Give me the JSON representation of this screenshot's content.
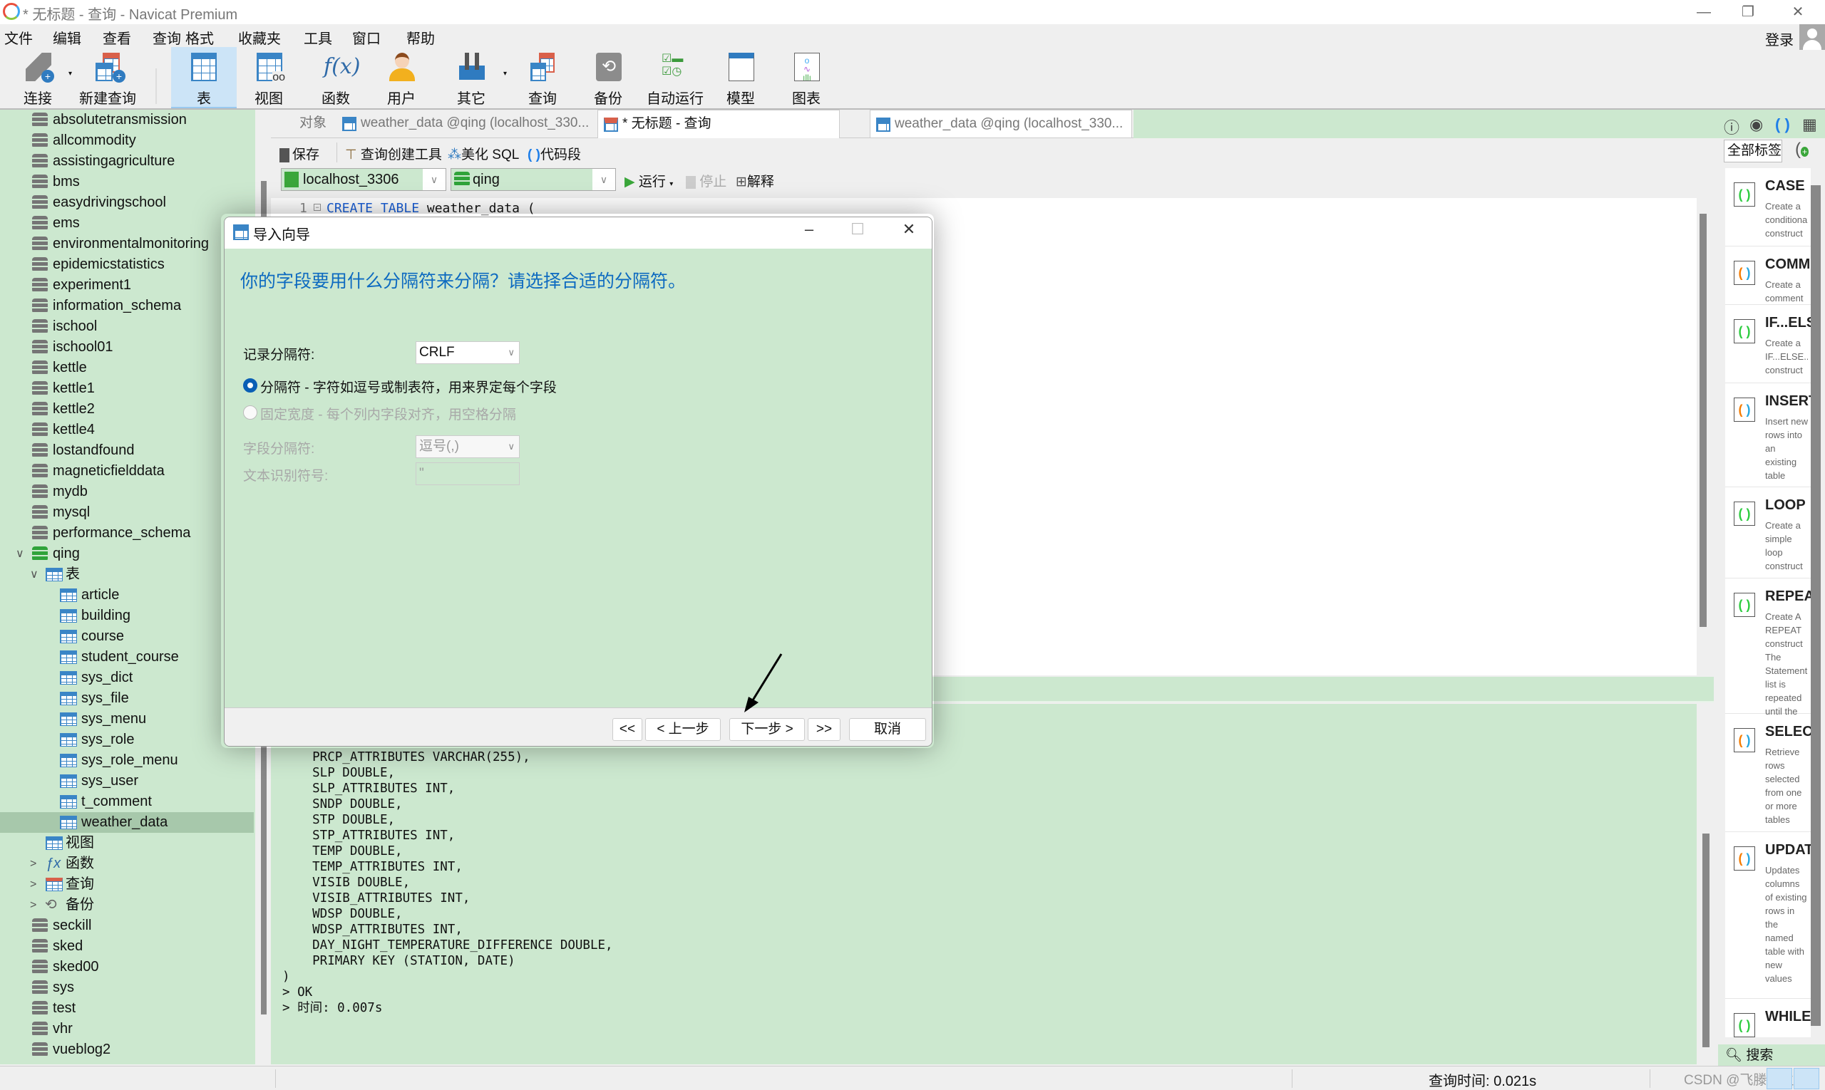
{
  "window": {
    "title": "* 无标题 - 查询 - Navicat Premium",
    "controls": {
      "minimize": "—",
      "restore": "❐",
      "close": "✕"
    }
  },
  "menu": [
    "文件",
    "编辑",
    "查看",
    "查询",
    "格式",
    "收藏夹",
    "工具",
    "窗口",
    "帮助"
  ],
  "account": {
    "login_label": "登录"
  },
  "toolbar": [
    {
      "label": "连接",
      "icon": "plug-icon",
      "has_dropdown": true
    },
    {
      "label": "新建查询",
      "icon": "new-query-icon"
    },
    {
      "label": "表",
      "icon": "table-icon",
      "active": true
    },
    {
      "label": "视图",
      "icon": "view-icon"
    },
    {
      "label": "函数",
      "icon": "function-icon"
    },
    {
      "label": "用户",
      "icon": "user-icon"
    },
    {
      "label": "其它",
      "icon": "tools-icon",
      "has_dropdown": true
    },
    {
      "label": "查询",
      "icon": "query-icon"
    },
    {
      "label": "备份",
      "icon": "backup-icon"
    },
    {
      "label": "自动运行",
      "icon": "schedule-icon"
    },
    {
      "label": "模型",
      "icon": "model-icon"
    },
    {
      "label": "图表",
      "icon": "chart-icon"
    }
  ],
  "sidebar": {
    "databases_before": [
      "absolutetransmission",
      "allcommodity",
      "assistingagriculture",
      "bms",
      "easydrivingschool",
      "ems",
      "environmentalmonitoring",
      "epidemicstatistics",
      "experiment1",
      "information_schema",
      "ischool",
      "ischool01",
      "kettle",
      "kettle1",
      "kettle2",
      "kettle4",
      "lostandfound",
      "magneticfielddata",
      "mydb",
      "mysql",
      "performance_schema"
    ],
    "open_database": "qing",
    "tables_group": "表",
    "tables": [
      "article",
      "building",
      "course",
      "student_course",
      "sys_dict",
      "sys_file",
      "sys_menu",
      "sys_role",
      "sys_role_menu",
      "sys_user",
      "t_comment",
      "weather_data"
    ],
    "selected_table": "weather_data",
    "other_groups": [
      "视图",
      "函数",
      "查询",
      "备份"
    ],
    "databases_after": [
      "seckill",
      "sked",
      "sked00",
      "sys",
      "test",
      "vhr",
      "vueblog2"
    ]
  },
  "tabs": [
    {
      "label": "对象"
    },
    {
      "label": "weather_data @qing (localhost_330..."
    },
    {
      "label": "* 无标题 - 查询",
      "active": true
    },
    {
      "label": "weather_data @qing (localhost_330..."
    }
  ],
  "editor_toolbar": {
    "save": "保存",
    "query_builder": "查询创建工具",
    "beautify": "美化 SQL",
    "snippet": "代码段",
    "connection": "localhost_3306",
    "database": "qing",
    "run": "运行",
    "stop": "停止",
    "explain": "解释"
  },
  "editor": {
    "line_number": "1",
    "code_keyword": "CREATE TABLE",
    "code_rest": " weather_data ("
  },
  "results": {
    "lines": [
      "    PRCP_ATTRIBUTES VARCHAR(255),",
      "    SLP DOUBLE,",
      "    SLP_ATTRIBUTES INT,",
      "    SNDP DOUBLE,",
      "    STP DOUBLE,",
      "    STP_ATTRIBUTES INT,",
      "    TEMP DOUBLE,",
      "    TEMP_ATTRIBUTES INT,",
      "    VISIB DOUBLE,",
      "    VISIB_ATTRIBUTES INT,",
      "    WDSP DOUBLE,",
      "    WDSP_ATTRIBUTES INT,",
      "    DAY_NIGHT_TEMPERATURE_DIFFERENCE DOUBLE,",
      "    PRIMARY KEY (STATION, DATE)",
      ")",
      "> OK",
      "> 时间: 0.007s"
    ]
  },
  "snippets_panel": {
    "filter": "全部标签",
    "search_placeholder": "搜索",
    "items": [
      {
        "title": "CASE",
        "desc": "Create a conditional construct",
        "color": "green"
      },
      {
        "title": "COMMENT",
        "desc": "Create a comment",
        "color": "multi"
      },
      {
        "title": "IF...ELSE",
        "desc": "Create a IF...ELSE... construct",
        "color": "green"
      },
      {
        "title": "INSERT",
        "desc": "Insert new rows into an existing table",
        "color": "multi"
      },
      {
        "title": "LOOP",
        "desc": "Create a simple loop construct",
        "color": "green"
      },
      {
        "title": "REPEAT",
        "desc": "Create A REPEAT construct The Statement list is repeated until the",
        "color": "green"
      },
      {
        "title": "SELECT",
        "desc": "Retrieve rows selected from one or more tables",
        "color": "multi"
      },
      {
        "title": "UPDATE",
        "desc": "Updates columns of existing rows in the named table with new values",
        "color": "multi"
      },
      {
        "title": "WHILE",
        "desc": "",
        "color": "green"
      }
    ]
  },
  "status": {
    "query_time": "查询时间: 0.021s",
    "watermark": "CSDN @飞滕人生TYF"
  },
  "dialog": {
    "title": "导入向导",
    "question": "你的字段要用什么分隔符来分隔？请选择合适的分隔符。",
    "record_delimiter_label": "记录分隔符:",
    "record_delimiter_value": "CRLF",
    "option_delimited": "分隔符 - 字符如逗号或制表符，用来界定每个字段",
    "option_fixed": "固定宽度 - 每个列内字段对齐，用空格分隔",
    "selected_option": "delimited",
    "field_delimiter_label": "字段分隔符:",
    "field_delimiter_value": "逗号(,)",
    "text_qualifier_label": "文本识别符号:",
    "text_qualifier_value": "\"",
    "buttons": {
      "first": "<<",
      "back": "< 上一步",
      "next": "下一步 >",
      "last": ">>",
      "cancel": "取消"
    }
  },
  "colors": {
    "panel_green": "#cce8cf",
    "question_blue": "#0d6ac0",
    "keyword_blue": "#1a5fd6",
    "selection": "#a7c8ab"
  }
}
